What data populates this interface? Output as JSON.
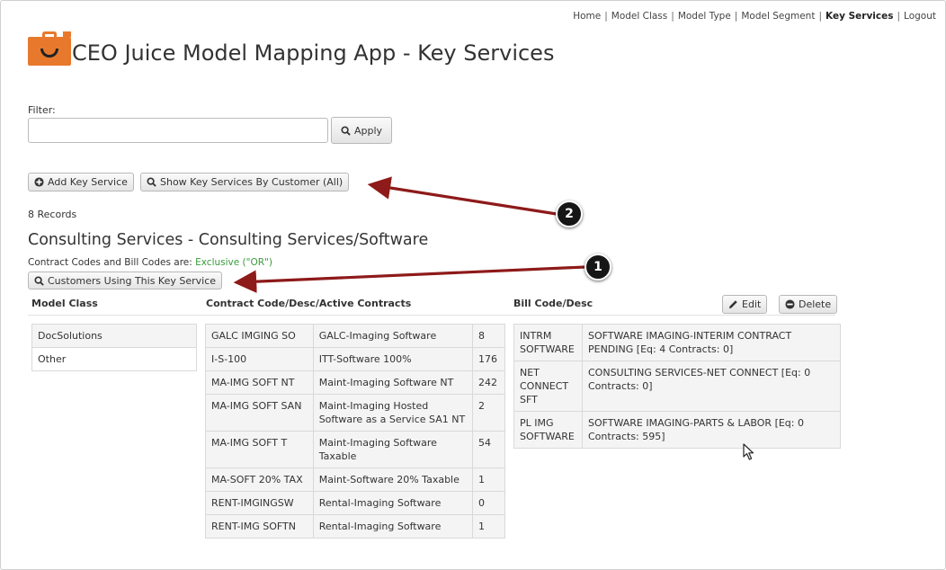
{
  "nav": {
    "home": "Home",
    "model_class": "Model Class",
    "model_type": "Model Type",
    "model_segment": "Model Segment",
    "key_services": "Key Services",
    "logout": "Logout",
    "separator": "|"
  },
  "app": {
    "title": "CEO Juice Model Mapping App - Key Services",
    "accent_color": "#e8792c"
  },
  "filter": {
    "label": "Filter:",
    "value": "",
    "apply_label": "Apply"
  },
  "toolbar": {
    "add_label": "Add Key Service",
    "show_by_customer_label": "Show Key Services By Customer (All)"
  },
  "records_text": "8 Records",
  "key_service": {
    "title": "Consulting Services - Consulting Services/Software",
    "codes_prefix": "Contract Codes and Bill Codes are:",
    "codes_mode": "Exclusive (\"OR\")",
    "customers_button": "Customers Using This Key Service",
    "edit_label": "Edit",
    "delete_label": "Delete"
  },
  "columns": {
    "model_class": "Model Class",
    "contract": "Contract Code/Desc/Active Contracts",
    "bill": "Bill Code/Desc"
  },
  "model_classes": [
    "DocSolutions",
    "Other"
  ],
  "contract_codes": [
    {
      "code": "GALC IMGING SO",
      "desc": "GALC-Imaging Software",
      "count": "8"
    },
    {
      "code": "I-S-100",
      "desc": "ITT-Software 100%",
      "count": "176"
    },
    {
      "code": "MA-IMG SOFT NT",
      "desc": "Maint-Imaging Software NT",
      "count": "242"
    },
    {
      "code": "MA-IMG SOFT SAN",
      "desc": "Maint-Imaging Hosted Software as a Service SA1 NT",
      "count": "2"
    },
    {
      "code": "MA-IMG SOFT T",
      "desc": "Maint-Imaging Software Taxable",
      "count": "54"
    },
    {
      "code": "MA-SOFT 20% TAX",
      "desc": "Maint-Software 20% Taxable",
      "count": "1"
    },
    {
      "code": "RENT-IMGINGSW",
      "desc": "Rental-Imaging Software",
      "count": "0"
    },
    {
      "code": "RENT-IMG SOFTN",
      "desc": "Rental-Imaging Software",
      "count": "1"
    }
  ],
  "bill_codes": [
    {
      "code": "INTRM SOFTWARE",
      "desc": "SOFTWARE IMAGING-INTERIM CONTRACT PENDING [Eq: 4 Contracts: 0]"
    },
    {
      "code": "NET CONNECT SFT",
      "desc": "CONSULTING SERVICES-NET CONNECT [Eq: 0 Contracts: 0]"
    },
    {
      "code": "PL IMG SOFTWARE",
      "desc": "SOFTWARE IMAGING-PARTS & LABOR [Eq: 0 Contracts: 595]"
    }
  ],
  "annotations": {
    "callout_1": "1",
    "callout_2": "2",
    "arrow_color": "#8e1a1a"
  }
}
